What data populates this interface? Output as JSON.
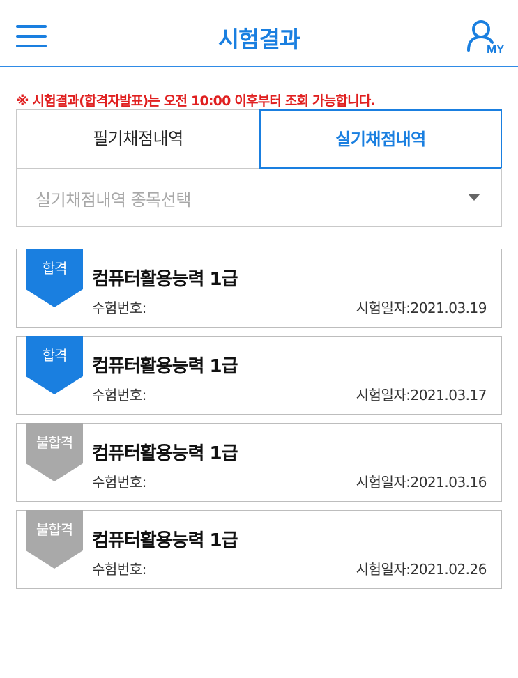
{
  "header": {
    "title": "시험결과",
    "my_label": "MY",
    "menu_icon": "hamburger-menu-icon",
    "accent_color": "#1a7fe0"
  },
  "notice": {
    "mark": "※",
    "text_before": " 시험결과(합격자발표)는 오전 ",
    "time": "10:00",
    "text_after": " 이후부터 조회 가능합니다.",
    "color": "#e02020"
  },
  "tabs": [
    {
      "label": "필기채점내역",
      "active": false
    },
    {
      "label": "실기채점내역",
      "active": true
    }
  ],
  "select": {
    "placeholder": "실기채점내역 종목선택",
    "arrow_icon": "caret-down-icon"
  },
  "results": [
    {
      "status": "합격",
      "status_color": "#1a7fe0",
      "title": "컴퓨터활용능력 1급",
      "exam_number_label": "수험번호:",
      "exam_date": "시험일자:2021.03.19"
    },
    {
      "status": "합격",
      "status_color": "#1a7fe0",
      "title": "컴퓨터활용능력 1급",
      "exam_number_label": "수험번호:",
      "exam_date": "시험일자:2021.03.17"
    },
    {
      "status": "불합격",
      "status_color": "#a9a9a9",
      "title": "컴퓨터활용능력 1급",
      "exam_number_label": "수험번호:",
      "exam_date": "시험일자:2021.03.16"
    },
    {
      "status": "불합격",
      "status_color": "#a9a9a9",
      "title": "컴퓨터활용능력 1급",
      "exam_number_label": "수험번호:",
      "exam_date": "시험일자:2021.02.26"
    }
  ]
}
